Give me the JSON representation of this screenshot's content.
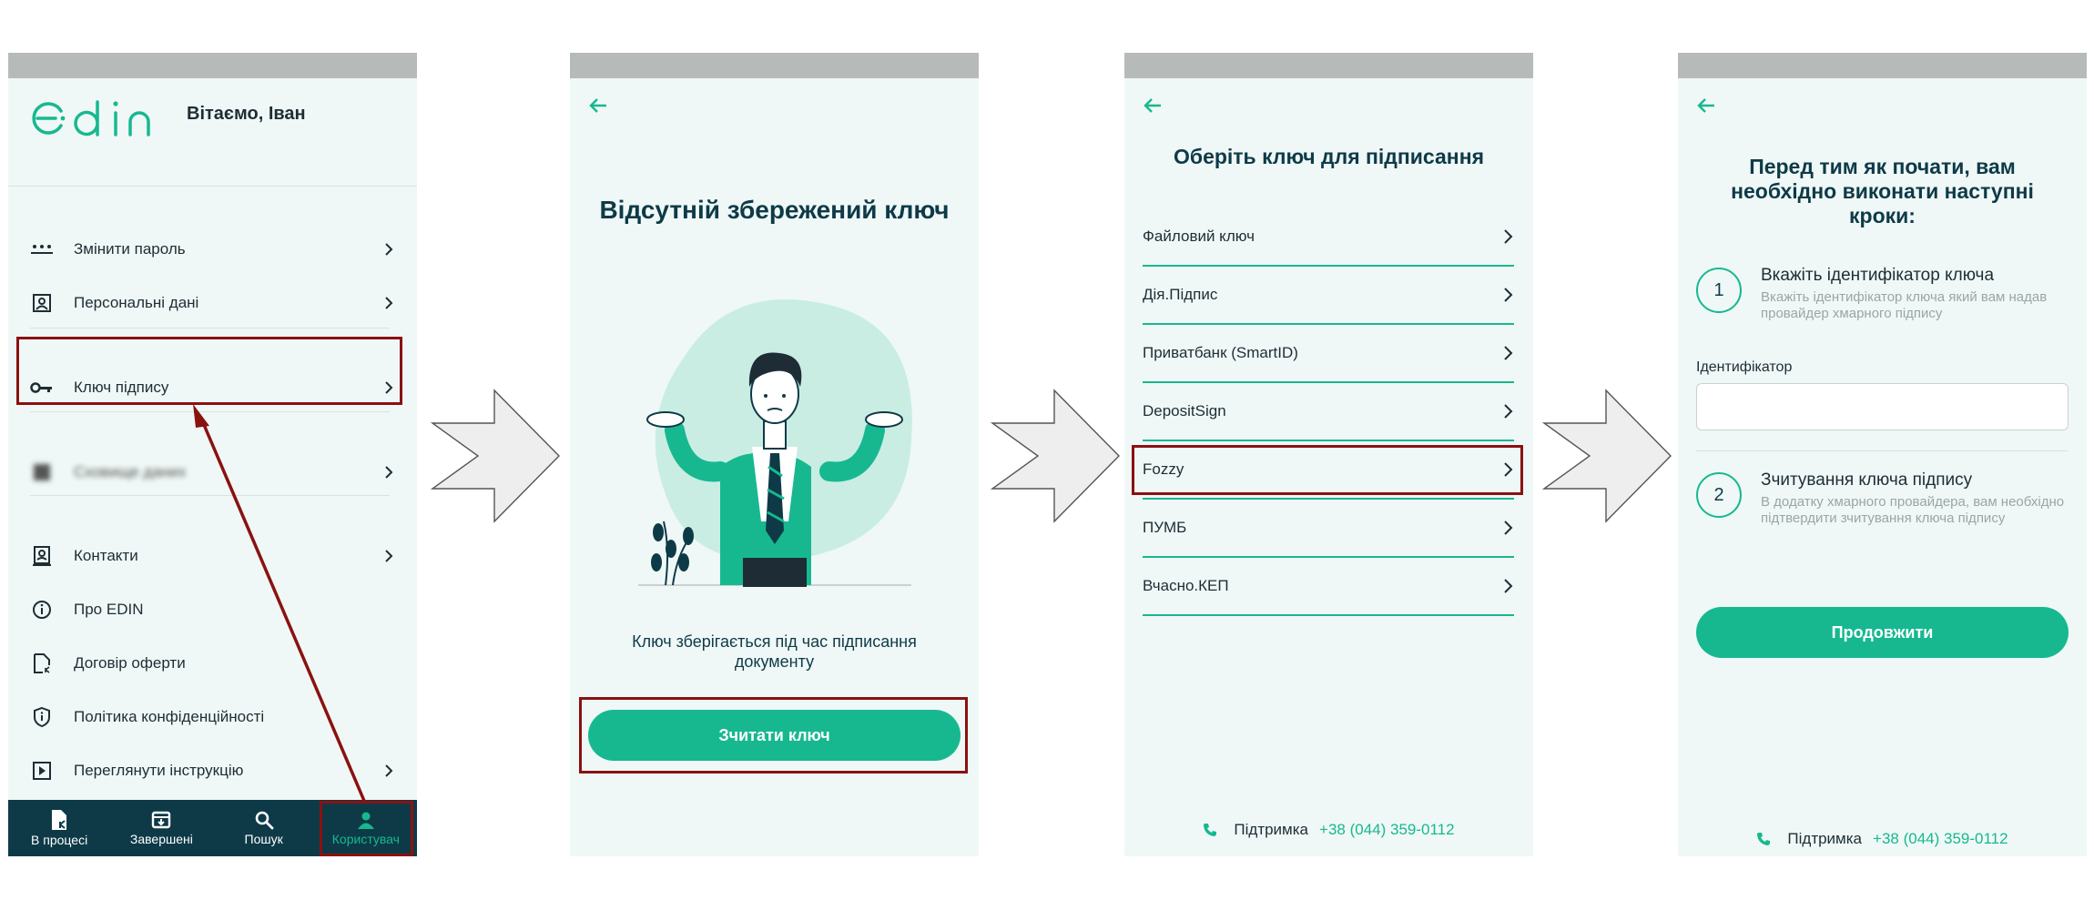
{
  "colors": {
    "accent": "#17b890",
    "dark_navy": "#0e3a48",
    "highlight": "#8b1111",
    "screen_bg": "#eff8f6",
    "statusbar": "#b6bbba"
  },
  "screen1": {
    "greeting": "Вітаємо, Іван",
    "logo_text": "edin",
    "menu": [
      {
        "label": "Змінити пароль",
        "icon": "password-icon"
      },
      {
        "label": "Персональні дані",
        "icon": "id-card-icon"
      },
      {
        "label": "Ключ підпису",
        "icon": "key-icon"
      },
      {
        "label": "Сховище даних",
        "icon": "blurred-icon"
      },
      {
        "label": "Контакти",
        "icon": "contacts-icon"
      },
      {
        "label": "Про EDIN",
        "icon": "info-icon"
      },
      {
        "label": "Договір оферти",
        "icon": "document-icon"
      },
      {
        "label": "Політика конфіденційності",
        "icon": "shield-icon"
      },
      {
        "label": "Переглянути інструкцію",
        "icon": "play-icon"
      }
    ],
    "nav": [
      {
        "label": "В процесі",
        "icon": "in-progress-icon"
      },
      {
        "label": "Завершені",
        "icon": "archive-icon"
      },
      {
        "label": "Пошук",
        "icon": "search-icon"
      },
      {
        "label": "Користувач",
        "icon": "user-icon"
      }
    ]
  },
  "screen2": {
    "title": "Відсутній збережений ключ",
    "info": "Ключ зберігається під час підписання документу",
    "button": "Зчитати ключ"
  },
  "screen3": {
    "title": "Оберіть ключ для підписання",
    "keys": [
      "Файловий ключ",
      "Дія.Підпис",
      "Приватбанк (SmartID)",
      "DepositSign",
      "Fozzy",
      "ПУМБ",
      "Вчасно.КЕП"
    ],
    "support_label": "Підтримка",
    "support_phone": "+38 (044) 359-0112"
  },
  "screen4": {
    "title": "Перед тим як почати, вам необхідно виконати наступні кроки:",
    "step1_num": "1",
    "step1_title": "Вкажіть ідентифікатор ключа",
    "step1_desc": "Вкажіть ідентифікатор ключа який вам надав провайдер хмарного підпису",
    "field_label": "Ідентифікатор",
    "field_value": "",
    "step2_num": "2",
    "step2_title": "Зчитування ключа підпису",
    "step2_desc": "В додатку хмарного провайдера, вам необхідно підтвердити зчитування ключа підпису",
    "button": "Продовжити",
    "support_label": "Підтримка",
    "support_phone": "+38 (044) 359-0112"
  }
}
